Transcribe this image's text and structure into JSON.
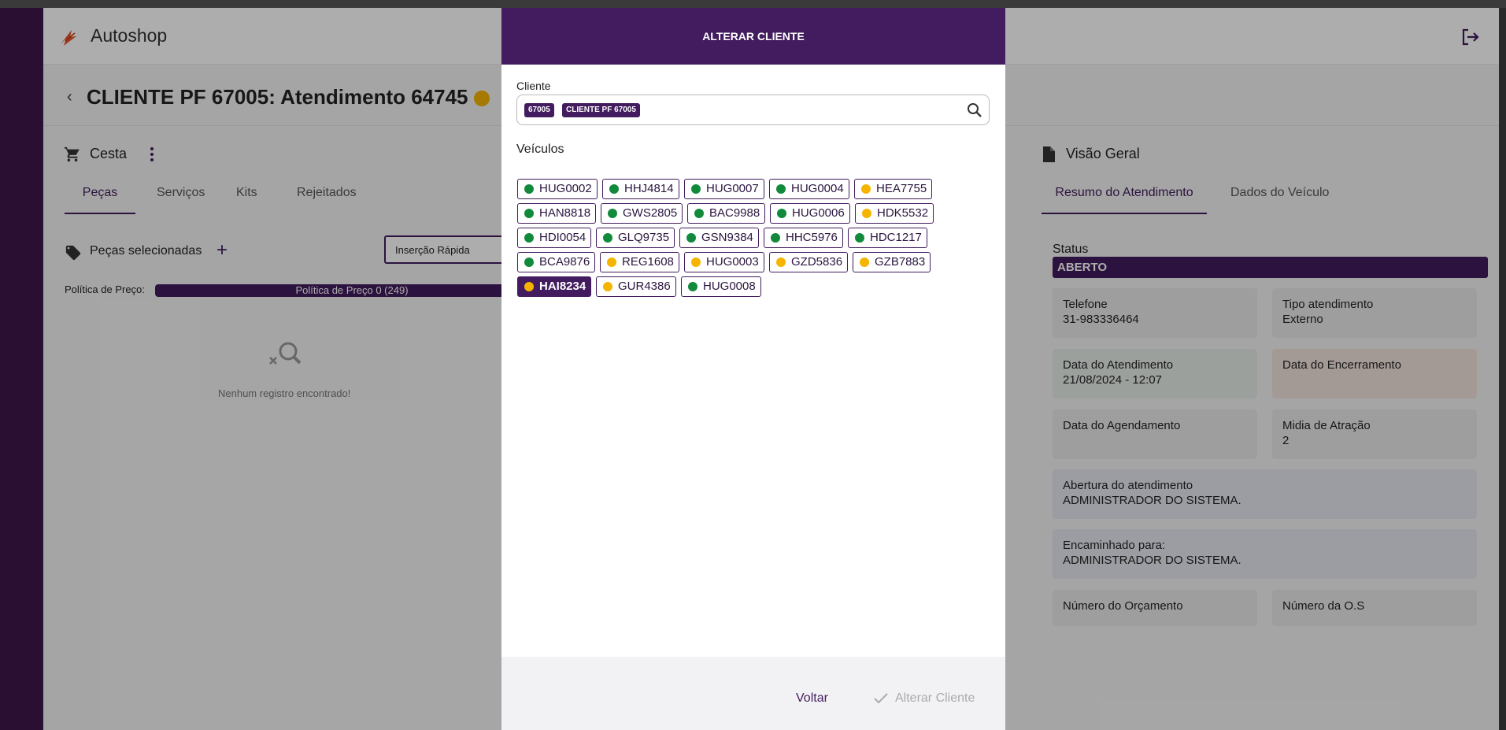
{
  "app": {
    "title": "Autoshop",
    "accent": "#421c5e"
  },
  "page": {
    "title": "CLIENTE PF 67005: Atendimento 64745",
    "status_color": "#f5b400"
  },
  "cesta": {
    "title": "Cesta",
    "tabs": [
      {
        "label": "Peças",
        "active": true
      },
      {
        "label": "Serviços",
        "active": false
      },
      {
        "label": "Kits",
        "active": false
      },
      {
        "label": "Rejeitados",
        "active": false
      }
    ],
    "selected_title": "Peças selecionadas",
    "quick_insert_label": "Inserção Rápida",
    "policy_label": "Política de Preço:",
    "policy_value": "Política de Preço 0 (249)",
    "empty_text": "Nenhum registro encontrado!"
  },
  "overview": {
    "title": "Visão Geral",
    "tabs": [
      {
        "label": "Resumo do Atendimento",
        "active": true
      },
      {
        "label": "Dados do Veículo",
        "active": false
      }
    ],
    "status_label": "Status",
    "status_value": "ABERTO",
    "cards": [
      {
        "label": "Telefone",
        "value": "31-983336464"
      },
      {
        "label": "Tipo atendimento",
        "value": "Externo"
      },
      {
        "label": "Data do Atendimento",
        "value": "21/08/2024 - 12:07"
      },
      {
        "label": "Data do Encerramento",
        "value": ""
      },
      {
        "label": "Data do Agendamento",
        "value": ""
      },
      {
        "label": "Midia de Atração",
        "value": "2"
      },
      {
        "label": "Abertura do atendimento",
        "value": "ADMINISTRADOR DO SISTEMA."
      },
      {
        "label": "Encaminhado para:",
        "value": "ADMINISTRADOR DO SISTEMA."
      },
      {
        "label": "Número do Orçamento",
        "value": ""
      },
      {
        "label": "Número da O.S",
        "value": ""
      }
    ]
  },
  "modal": {
    "title": "ALTERAR CLIENTE",
    "cliente_label": "Cliente",
    "cliente_chips": [
      "67005",
      "CLIENTE PF 67005"
    ],
    "veiculos_label": "Veículos",
    "status_colors": {
      "green": "#128a3c",
      "yellow": "#f5b400"
    },
    "vehicles": [
      {
        "plate": "HUG0002",
        "status": "green",
        "selected": false
      },
      {
        "plate": "HHJ4814",
        "status": "green",
        "selected": false
      },
      {
        "plate": "HUG0007",
        "status": "green",
        "selected": false
      },
      {
        "plate": "HUG0004",
        "status": "green",
        "selected": false
      },
      {
        "plate": "HEA7755",
        "status": "yellow",
        "selected": false
      },
      {
        "plate": "HAN8818",
        "status": "green",
        "selected": false
      },
      {
        "plate": "GWS2805",
        "status": "green",
        "selected": false
      },
      {
        "plate": "BAC9988",
        "status": "green",
        "selected": false
      },
      {
        "plate": "HUG0006",
        "status": "green",
        "selected": false
      },
      {
        "plate": "HDK5532",
        "status": "yellow",
        "selected": false
      },
      {
        "plate": "HDI0054",
        "status": "green",
        "selected": false
      },
      {
        "plate": "GLQ9735",
        "status": "green",
        "selected": false
      },
      {
        "plate": "GSN9384",
        "status": "green",
        "selected": false
      },
      {
        "plate": "HHC5976",
        "status": "green",
        "selected": false
      },
      {
        "plate": "HDC1217",
        "status": "green",
        "selected": false
      },
      {
        "plate": "BCA9876",
        "status": "green",
        "selected": false
      },
      {
        "plate": "REG1608",
        "status": "yellow",
        "selected": false
      },
      {
        "plate": "HUG0003",
        "status": "yellow",
        "selected": false
      },
      {
        "plate": "GZD5836",
        "status": "yellow",
        "selected": false
      },
      {
        "plate": "GZB7883",
        "status": "yellow",
        "selected": false
      },
      {
        "plate": "HAI8234",
        "status": "yellow",
        "selected": true
      },
      {
        "plate": "GUR4386",
        "status": "yellow",
        "selected": false
      },
      {
        "plate": "HUG0008",
        "status": "green",
        "selected": false
      }
    ],
    "back_label": "Voltar",
    "confirm_label": "Alterar Cliente"
  }
}
